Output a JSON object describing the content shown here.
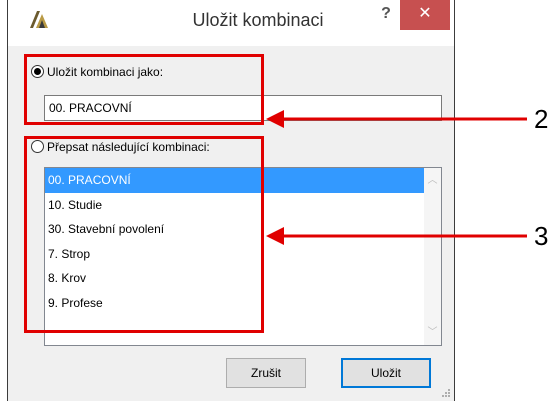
{
  "window": {
    "title": "Uložit kombinaci",
    "help_label": "?",
    "close_label": "✕",
    "icon": "archicad-logo-icon"
  },
  "save_as": {
    "radio_label": "Uložit kombinaci jako:",
    "selected": true,
    "value": "00. PRACOVNÍ"
  },
  "overwrite": {
    "radio_label": "Přepsat následující kombinaci:",
    "selected": false,
    "items": [
      "00. PRACOVNÍ",
      "10. Studie",
      "30. Stavební povolení",
      "7. Strop",
      "8. Krov",
      "9. Profese"
    ],
    "selected_index": 0
  },
  "buttons": {
    "cancel_label": "Zrušit",
    "save_label": "Uložit"
  },
  "callouts": [
    "2",
    "3"
  ],
  "colors": {
    "annotation": "#e00000",
    "selection": "#3399ff",
    "close_button": "#c75050"
  }
}
